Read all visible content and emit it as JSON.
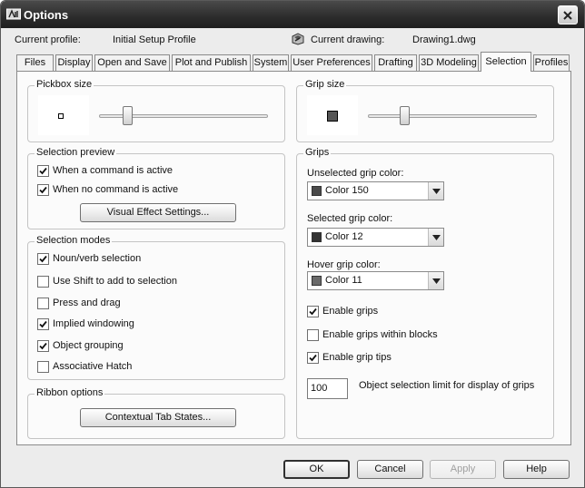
{
  "window": {
    "title": "Options"
  },
  "profile": {
    "current_profile_label": "Current profile:",
    "current_profile_value": "Initial Setup Profile",
    "current_drawing_label": "Current drawing:",
    "current_drawing_value": "Drawing1.dwg"
  },
  "tabs": [
    {
      "label": "Files"
    },
    {
      "label": "Display"
    },
    {
      "label": "Open and Save"
    },
    {
      "label": "Plot and Publish"
    },
    {
      "label": "System"
    },
    {
      "label": "User Preferences"
    },
    {
      "label": "Drafting"
    },
    {
      "label": "3D Modeling"
    },
    {
      "label": "Selection",
      "active": true
    },
    {
      "label": "Profiles"
    }
  ],
  "pickbox": {
    "title": "Pickbox size",
    "slider_level": 0.17
  },
  "grip_size": {
    "title": "Grip size",
    "slider_level": 0.22
  },
  "selection_preview": {
    "title": "Selection preview",
    "items": [
      {
        "label": "When a command is active",
        "checked": true
      },
      {
        "label": "When no command is active",
        "checked": true
      }
    ],
    "button": "Visual Effect Settings..."
  },
  "selection_modes": {
    "title": "Selection modes",
    "items": [
      {
        "label": "Noun/verb selection",
        "checked": true
      },
      {
        "label": "Use Shift to add to selection",
        "checked": false
      },
      {
        "label": "Press and drag",
        "checked": false
      },
      {
        "label": "Implied windowing",
        "checked": true
      },
      {
        "label": "Object grouping",
        "checked": true
      },
      {
        "label": "Associative Hatch",
        "checked": false
      }
    ]
  },
  "ribbon_options": {
    "title": "Ribbon options",
    "button": "Contextual Tab States..."
  },
  "grips": {
    "title": "Grips",
    "unselected_label": "Unselected grip color:",
    "unselected_value": "Color 150",
    "unselected_color": "#4a4a4a",
    "selected_label": "Selected grip color:",
    "selected_value": "Color 12",
    "selected_color": "#333333",
    "hover_label": "Hover grip color:",
    "hover_value": "Color 11",
    "hover_color": "#6a6a6a",
    "options": [
      {
        "label": "Enable grips",
        "checked": true
      },
      {
        "label": "Enable grips within blocks",
        "checked": false
      },
      {
        "label": "Enable grip tips",
        "checked": true
      }
    ],
    "limit_value": "100",
    "limit_label": "Object selection limit for display of grips"
  },
  "footer": {
    "ok": "OK",
    "cancel": "Cancel",
    "apply": "Apply",
    "help": "Help"
  }
}
